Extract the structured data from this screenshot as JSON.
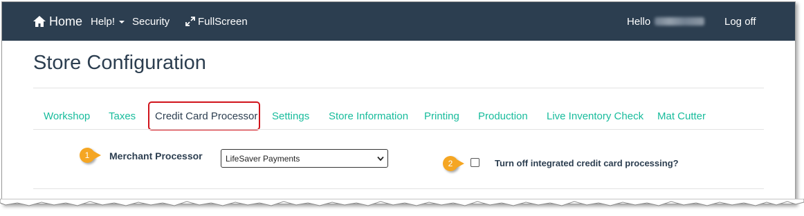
{
  "navbar": {
    "home_label": "Home",
    "help_label": "Help!",
    "security_label": "Security",
    "fullscreen_label": "FullScreen",
    "hello_label": "Hello",
    "logoff_label": "Log off"
  },
  "page": {
    "title": "Store Configuration"
  },
  "tabs": [
    {
      "label": "Workshop"
    },
    {
      "label": "Taxes"
    },
    {
      "label": "Credit Card Processor",
      "active": true
    },
    {
      "label": "Settings"
    },
    {
      "label": "Store Information"
    },
    {
      "label": "Printing"
    },
    {
      "label": "Production"
    },
    {
      "label": "Live Inventory Check"
    },
    {
      "label": "Mat Cutter"
    }
  ],
  "callouts": [
    "1",
    "2"
  ],
  "form": {
    "merchant_label": "Merchant Processor",
    "merchant_value": "LifeSaver Payments",
    "turnoff_label": "Turn off integrated credit card processing?",
    "turnoff_checked": false
  },
  "colors": {
    "navbar_bg": "#2c3e50",
    "tab_link": "#18bc9c",
    "highlight_box": "#d0121a",
    "callout_badge": "#f5a623"
  },
  "icons": [
    "home-icon",
    "caret-down-icon",
    "expand-icon",
    "chevron-down-icon"
  ]
}
